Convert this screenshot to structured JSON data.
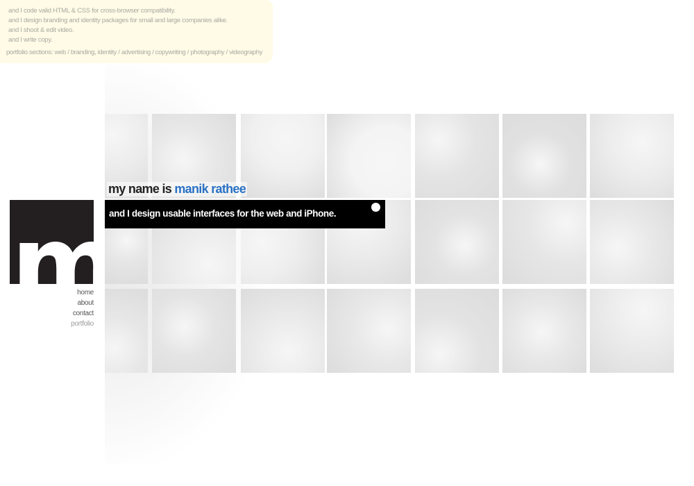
{
  "info_panel": {
    "lines": [
      "and I code valid HTML & CSS for cross-browser compatibility.",
      "and I design branding and identity packages for small and large companies alike.",
      "and I shoot & edit video.",
      "and I write copy."
    ],
    "sections_prefix": "portfolio sections:",
    "sections": [
      {
        "label": "web",
        "sep": "/"
      },
      {
        "label": "branding, identity",
        "sep": "/"
      },
      {
        "label": "advertising",
        "sep": "/"
      },
      {
        "label": "copywriting",
        "sep": "/"
      },
      {
        "label": "photography",
        "sep": "/"
      },
      {
        "label": "videography",
        "sep": ""
      }
    ]
  },
  "headline": {
    "prefix": "my name is",
    "name": "manik rathee"
  },
  "tagline": {
    "text": "and I design usable interfaces for the web and iPhone."
  },
  "logo": {
    "letter": "m",
    "background": "#231f20"
  },
  "nav": {
    "items": [
      "home",
      "about",
      "contact",
      "portfolio"
    ]
  },
  "colors": {
    "accent_blue": "#2a72c4",
    "panel_yellow": "#fffbe6"
  }
}
